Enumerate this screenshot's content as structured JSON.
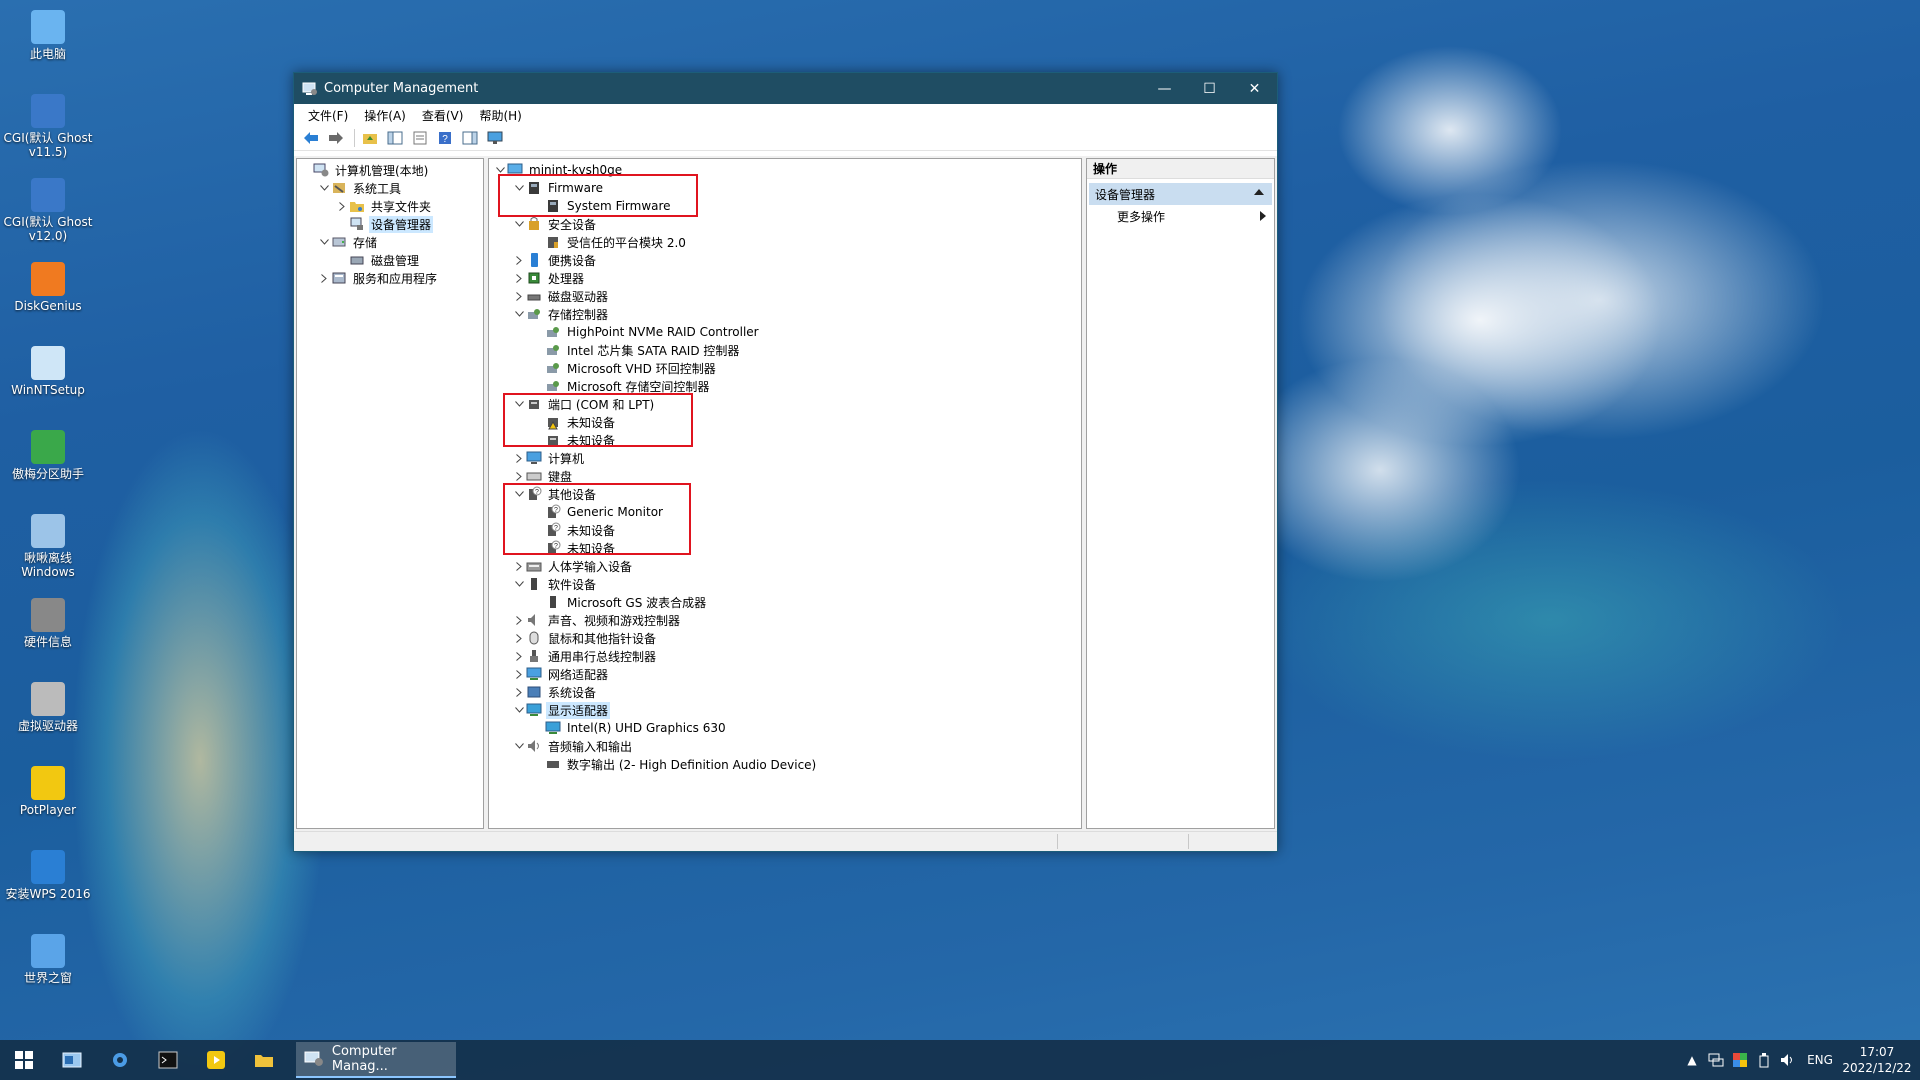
{
  "desktop": {
    "icons": [
      {
        "label": "此电脑",
        "icon": "computer-icon"
      },
      {
        "label": "CGI(默认 Ghost v11.5)",
        "icon": "ghost-icon"
      },
      {
        "label": "CGI(默认 Ghost v12.0)",
        "icon": "ghost-icon"
      },
      {
        "label": "DiskGenius",
        "icon": "diskgenius-icon"
      },
      {
        "label": "WinNTSetup",
        "icon": "setup-icon"
      },
      {
        "label": "傲梅分区助手",
        "icon": "partition-icon"
      },
      {
        "label": "啾啾离线 Windows",
        "icon": "gear-icon"
      },
      {
        "label": "硬件信息",
        "icon": "hardware-icon"
      },
      {
        "label": "虚拟驱动器",
        "icon": "virtual-drive-icon"
      },
      {
        "label": "PotPlayer",
        "icon": "potplayer-icon"
      },
      {
        "label": "安装WPS 2016",
        "icon": "wps-icon"
      },
      {
        "label": "世界之窗",
        "icon": "browser-icon"
      }
    ]
  },
  "window": {
    "title": "Computer Management",
    "menu": [
      "文件(F)",
      "操作(A)",
      "查看(V)",
      "帮助(H)"
    ],
    "left_tree": [
      {
        "label": "计算机管理(本地)",
        "level": 0,
        "expander": "",
        "icon": "computer-manage-icon"
      },
      {
        "label": "系统工具",
        "level": 1,
        "expander": "v",
        "icon": "tools-icon"
      },
      {
        "label": "共享文件夹",
        "level": 2,
        "expander": ">",
        "icon": "shared-folder-icon"
      },
      {
        "label": "设备管理器",
        "level": 2,
        "expander": "",
        "icon": "device-manager-icon",
        "selected": true
      },
      {
        "label": "存储",
        "level": 1,
        "expander": "v",
        "icon": "storage-icon"
      },
      {
        "label": "磁盘管理",
        "level": 2,
        "expander": "",
        "icon": "disk-icon"
      },
      {
        "label": "服务和应用程序",
        "level": 1,
        "expander": ">",
        "icon": "services-icon"
      }
    ],
    "device_tree": [
      {
        "label": "minint-kvsh0ge",
        "level": 0,
        "expander": "v",
        "icon": "computer-icon"
      },
      {
        "label": "Firmware",
        "level": 1,
        "expander": "v",
        "icon": "firmware-icon"
      },
      {
        "label": "System Firmware",
        "level": 2,
        "expander": "",
        "icon": "firmware-icon"
      },
      {
        "label": "安全设备",
        "level": 1,
        "expander": "v",
        "icon": "security-icon"
      },
      {
        "label": "受信任的平台模块 2.0",
        "level": 2,
        "expander": "",
        "icon": "tpm-icon"
      },
      {
        "label": "便携设备",
        "level": 1,
        "expander": ">",
        "icon": "portable-icon"
      },
      {
        "label": "处理器",
        "level": 1,
        "expander": ">",
        "icon": "cpu-icon"
      },
      {
        "label": "磁盘驱动器",
        "level": 1,
        "expander": ">",
        "icon": "disk-drive-icon"
      },
      {
        "label": "存储控制器",
        "level": 1,
        "expander": "v",
        "icon": "storage-controller-icon"
      },
      {
        "label": "HighPoint NVMe RAID Controller",
        "level": 2,
        "expander": "",
        "icon": "storage-controller-icon"
      },
      {
        "label": "Intel 芯片集 SATA RAID 控制器",
        "level": 2,
        "expander": "",
        "icon": "storage-controller-icon"
      },
      {
        "label": "Microsoft VHD 环回控制器",
        "level": 2,
        "expander": "",
        "icon": "storage-controller-icon"
      },
      {
        "label": "Microsoft 存储空间控制器",
        "level": 2,
        "expander": "",
        "icon": "storage-controller-icon"
      },
      {
        "label": "端口 (COM 和 LPT)",
        "level": 1,
        "expander": "v",
        "icon": "port-icon"
      },
      {
        "label": "未知设备",
        "level": 2,
        "expander": "",
        "icon": "warning-device-icon"
      },
      {
        "label": "未知设备",
        "level": 2,
        "expander": "",
        "icon": "port-icon"
      },
      {
        "label": "计算机",
        "level": 1,
        "expander": ">",
        "icon": "monitor-icon"
      },
      {
        "label": "键盘",
        "level": 1,
        "expander": ">",
        "icon": "keyboard-icon"
      },
      {
        "label": "其他设备",
        "level": 1,
        "expander": "v",
        "icon": "unknown-device-icon"
      },
      {
        "label": "Generic Monitor",
        "level": 2,
        "expander": "",
        "icon": "unknown-device-icon"
      },
      {
        "label": "未知设备",
        "level": 2,
        "expander": "",
        "icon": "unknown-device-icon"
      },
      {
        "label": "未知设备",
        "level": 2,
        "expander": "",
        "icon": "unknown-device-icon"
      },
      {
        "label": "人体学输入设备",
        "level": 1,
        "expander": ">",
        "icon": "hid-icon"
      },
      {
        "label": "软件设备",
        "level": 1,
        "expander": "v",
        "icon": "software-device-icon"
      },
      {
        "label": "Microsoft GS 波表合成器",
        "level": 2,
        "expander": "",
        "icon": "software-device-icon"
      },
      {
        "label": "声音、视频和游戏控制器",
        "level": 1,
        "expander": ">",
        "icon": "sound-icon"
      },
      {
        "label": "鼠标和其他指针设备",
        "level": 1,
        "expander": ">",
        "icon": "mouse-icon"
      },
      {
        "label": "通用串行总线控制器",
        "level": 1,
        "expander": ">",
        "icon": "usb-icon"
      },
      {
        "label": "网络适配器",
        "level": 1,
        "expander": ">",
        "icon": "network-icon"
      },
      {
        "label": "系统设备",
        "level": 1,
        "expander": ">",
        "icon": "system-device-icon"
      },
      {
        "label": "显示适配器",
        "level": 1,
        "expander": "v",
        "icon": "display-icon",
        "selected": true
      },
      {
        "label": "Intel(R) UHD Graphics 630",
        "level": 2,
        "expander": "",
        "icon": "display-icon"
      },
      {
        "label": "音频输入和输出",
        "level": 1,
        "expander": "v",
        "icon": "audio-icon"
      },
      {
        "label": "数字输出 (2- High Definition Audio Device)",
        "level": 2,
        "expander": "",
        "icon": "speaker-icon"
      }
    ],
    "actions": {
      "header": "操作",
      "section": "设备管理器",
      "more": "更多操作"
    }
  },
  "taskbar": {
    "active_task": "Computer Manag...",
    "lang": "ENG",
    "time": "17:07",
    "date": "2022/12/22"
  },
  "colors": {
    "highlight": "#e0141f",
    "titlebar": "#1f4d63",
    "selection": "#cce8ff"
  }
}
